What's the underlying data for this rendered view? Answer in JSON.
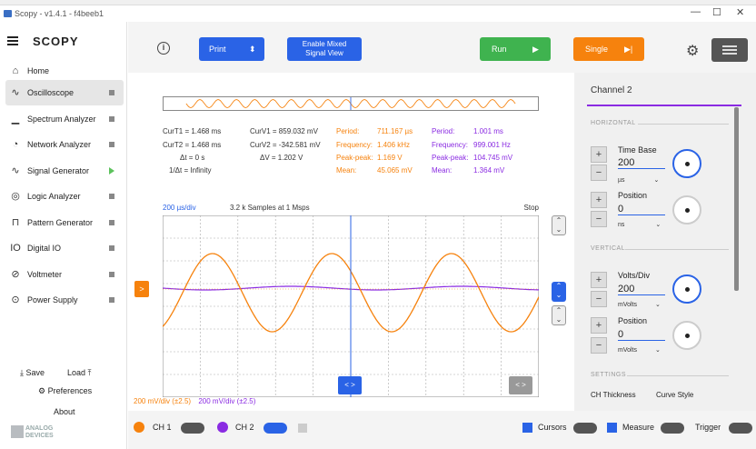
{
  "window": {
    "title": "Scopy - v1.4.1 - f4beeb1",
    "minimize_glyph": "—",
    "maximize_glyph": "☐",
    "close_glyph": "✕"
  },
  "sidebar": {
    "brand": "SCOPY",
    "items": [
      {
        "label": "Home",
        "icon": "home-icon",
        "glyph": "⌂"
      },
      {
        "label": "Oscilloscope",
        "icon": "oscilloscope-icon",
        "glyph": "∿"
      },
      {
        "label": "Spectrum Analyzer",
        "icon": "spectrum-icon",
        "glyph": "▁"
      },
      {
        "label": "Network Analyzer",
        "icon": "network-icon",
        "glyph": "◔"
      },
      {
        "label": "Signal Generator",
        "icon": "signal-icon",
        "glyph": "∿"
      },
      {
        "label": "Logic Analyzer",
        "icon": "logic-icon",
        "glyph": "◎"
      },
      {
        "label": "Pattern Generator",
        "icon": "pattern-icon",
        "glyph": "⊓"
      },
      {
        "label": "Digital IO",
        "icon": "digital-io-icon",
        "glyph": "IO"
      },
      {
        "label": "Voltmeter",
        "icon": "voltmeter-icon",
        "glyph": "⊘"
      },
      {
        "label": "Power Supply",
        "icon": "power-icon",
        "glyph": "⊙"
      }
    ],
    "save": "Save",
    "load": "Load",
    "preferences": "Preferences",
    "about": "About",
    "logo_line1": "ANALOG",
    "logo_line2": "DEVICES"
  },
  "toolbar": {
    "print": "Print",
    "print_glyph": "⬍",
    "mixed_line1": "Enable Mixed",
    "mixed_line2": "Signal View",
    "run": "Run",
    "run_glyph": "▶",
    "single": "Single",
    "single_glyph": "▶|",
    "info_glyph": "i",
    "gear_glyph": "⚙"
  },
  "cursors": {
    "curT1": "CurT1 = 1.468 ms",
    "curT2": "CurT2 = 1.468 ms",
    "dT": "Δt = 0 s",
    "invdT": "1/Δt = Infinity",
    "curV1": "CurV1 = 859.032 mV",
    "curV2": "CurV2 = -342.581 mV",
    "dV": "ΔV = 1.202 V",
    "ch1": {
      "period_label": "Period:",
      "period": "711.167 µs",
      "freq_label": "Frequency:",
      "freq": "1.406 kHz",
      "pp_label": "Peak-peak:",
      "pp": "1.169 V",
      "mean_label": "Mean:",
      "mean": "45.065 mV"
    },
    "ch2": {
      "period_label": "Period:",
      "period": "1.001 ms",
      "freq_label": "Frequency:",
      "freq": "999.001 Hz",
      "pp_label": "Peak-peak:",
      "pp": "104.745 mV",
      "mean_label": "Mean:",
      "mean": "1.364 mV"
    }
  },
  "plot": {
    "timebase": "200 µs/div",
    "samples": "3.2 k Samples at 1 Msps",
    "status": "Stop",
    "trigger_glyph": ">",
    "hpos_glyph": "< >",
    "ch1_scale": "200 mV/div (±2.5)",
    "ch2_scale": "200 mV/div (±2.5)",
    "ch1_color": "#f6820d",
    "ch2_color": "#8a2be2",
    "cursor_color": "#2a63e6"
  },
  "right_panel": {
    "title": "Channel 2",
    "horizontal": "HORIZONTAL",
    "time_base_label": "Time Base",
    "time_base_value": "200",
    "time_base_unit": "µs",
    "h_position_label": "Position",
    "h_position_value": "0",
    "h_position_unit": "ns",
    "vertical": "VERTICAL",
    "volts_div_label": "Volts/Div",
    "volts_div_value": "200",
    "volts_div_unit": "mVolts",
    "v_position_label": "Position",
    "v_position_value": "0",
    "v_position_unit": "mVolts",
    "settings": "SETTINGS",
    "ch_thickness": "CH Thickness",
    "curve_style": "Curve Style",
    "plus": "+",
    "minus": "−",
    "chevron": "⌄"
  },
  "bottom": {
    "ch1": "CH 1",
    "ch2": "CH 2",
    "cursors": "Cursors",
    "measure": "Measure",
    "trigger": "Trigger"
  }
}
